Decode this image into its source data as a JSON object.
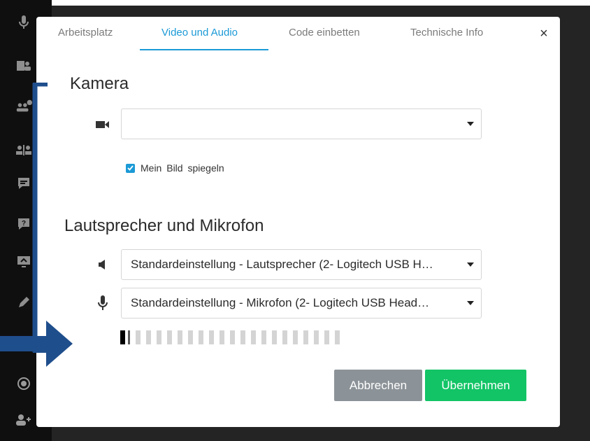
{
  "sidebar": {
    "icons": [
      "microphone-icon",
      "users-video-icon",
      "participants-badge-icon",
      "breakout-icon",
      "chat-icon",
      "question-icon",
      "screenshare-icon",
      "pen-icon",
      "record-icon",
      "add-user-icon"
    ]
  },
  "tabs": [
    {
      "label": "Arbeitsplatz"
    },
    {
      "label": "Video und Audio"
    },
    {
      "label": "Code einbetten"
    },
    {
      "label": "Technische Info"
    }
  ],
  "close_label": "×",
  "camera": {
    "title": "Kamera",
    "select_value": "",
    "mirror_label": "Mein Bild spiegeln",
    "mirror_checked": true
  },
  "audio": {
    "title": "Lautsprecher und Mikrofon",
    "speaker_value": "Standardeinstellung - Lautsprecher (2- Logitech USB H…",
    "mic_value": "Standardeinstellung - Mikrofon (2- Logitech USB Head…",
    "level_segments_total": 21,
    "level_segments_active": 1
  },
  "buttons": {
    "cancel": "Abbrechen",
    "apply": "Übernehmen"
  },
  "colors": {
    "accent": "#1b9ad6",
    "apply": "#12c466",
    "cancel": "#8c9398",
    "annotation": "#1f4e8c"
  }
}
